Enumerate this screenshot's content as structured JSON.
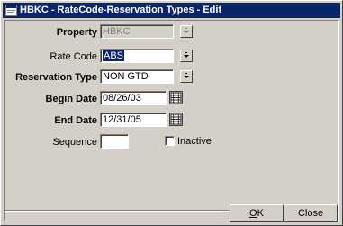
{
  "window": {
    "title": "HBKC - RateCode-Reservation Types - Edit"
  },
  "form": {
    "property": {
      "label": "Property",
      "value": "HBKC"
    },
    "rate_code": {
      "label": "Rate Code",
      "value": "ABS"
    },
    "reservation_type": {
      "label": "Reservation Type",
      "value": "NON GTD"
    },
    "begin_date": {
      "label": "Begin Date",
      "value": "08/26/03"
    },
    "end_date": {
      "label": "End Date",
      "value": "12/31/05"
    },
    "sequence": {
      "label": "Sequence",
      "value": ""
    },
    "inactive": {
      "label": "Inactive",
      "checked": false
    }
  },
  "buttons": {
    "ok": {
      "accel": "O",
      "rest": "K"
    },
    "close": {
      "label": "Close"
    }
  },
  "icons": {
    "title": "app-window-icon",
    "dropdown": "dropdown-arrow-icon",
    "calendar": "calendar-icon"
  }
}
